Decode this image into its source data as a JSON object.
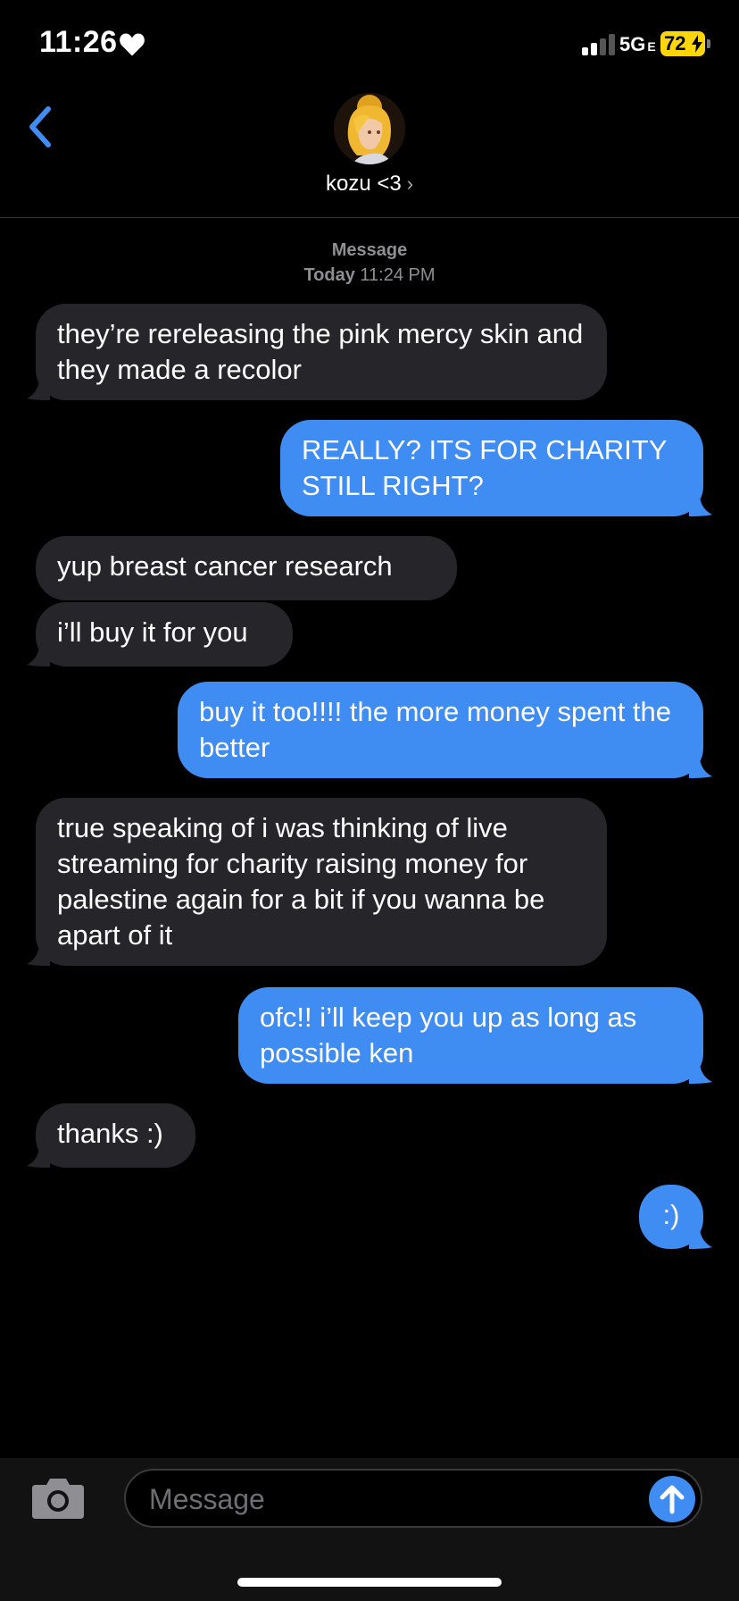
{
  "status_bar": {
    "time": "11:26",
    "network": "5G",
    "network_suffix": "E",
    "battery": "72",
    "signal_bars_filled": 2,
    "signal_bars_total": 4
  },
  "header": {
    "contact_name": "kozu <3",
    "chevron": "›"
  },
  "thread_meta": {
    "label": "Message",
    "day": "Today",
    "time": "11:24 PM"
  },
  "messages": [
    {
      "from": "them",
      "text": "they’re rereleasing the pink mercy skin and they made a recolor"
    },
    {
      "from": "me",
      "text": "REALLY? ITS FOR CHARITY STILL RIGHT?"
    },
    {
      "from": "them",
      "text": "yup breast cancer research"
    },
    {
      "from": "them",
      "text": "i’ll buy it for you"
    },
    {
      "from": "me",
      "text": "buy it too!!!! the more money spent the better"
    },
    {
      "from": "them",
      "text": "true speaking of i was thinking of live streaming for charity raising money for palestine again for a bit if you wanna be apart of it"
    },
    {
      "from": "me",
      "text": "ofc!! i’ll keep you up as long as possible ken"
    },
    {
      "from": "them",
      "text": "thanks :)"
    },
    {
      "from": "me",
      "text": ":)"
    }
  ],
  "compose": {
    "placeholder": "Message"
  },
  "colors": {
    "outgoing_bubble": "#3f8cf2",
    "incoming_bubble": "#26252a",
    "accent": "#3f8cf2",
    "battery": "#ffd60a"
  }
}
